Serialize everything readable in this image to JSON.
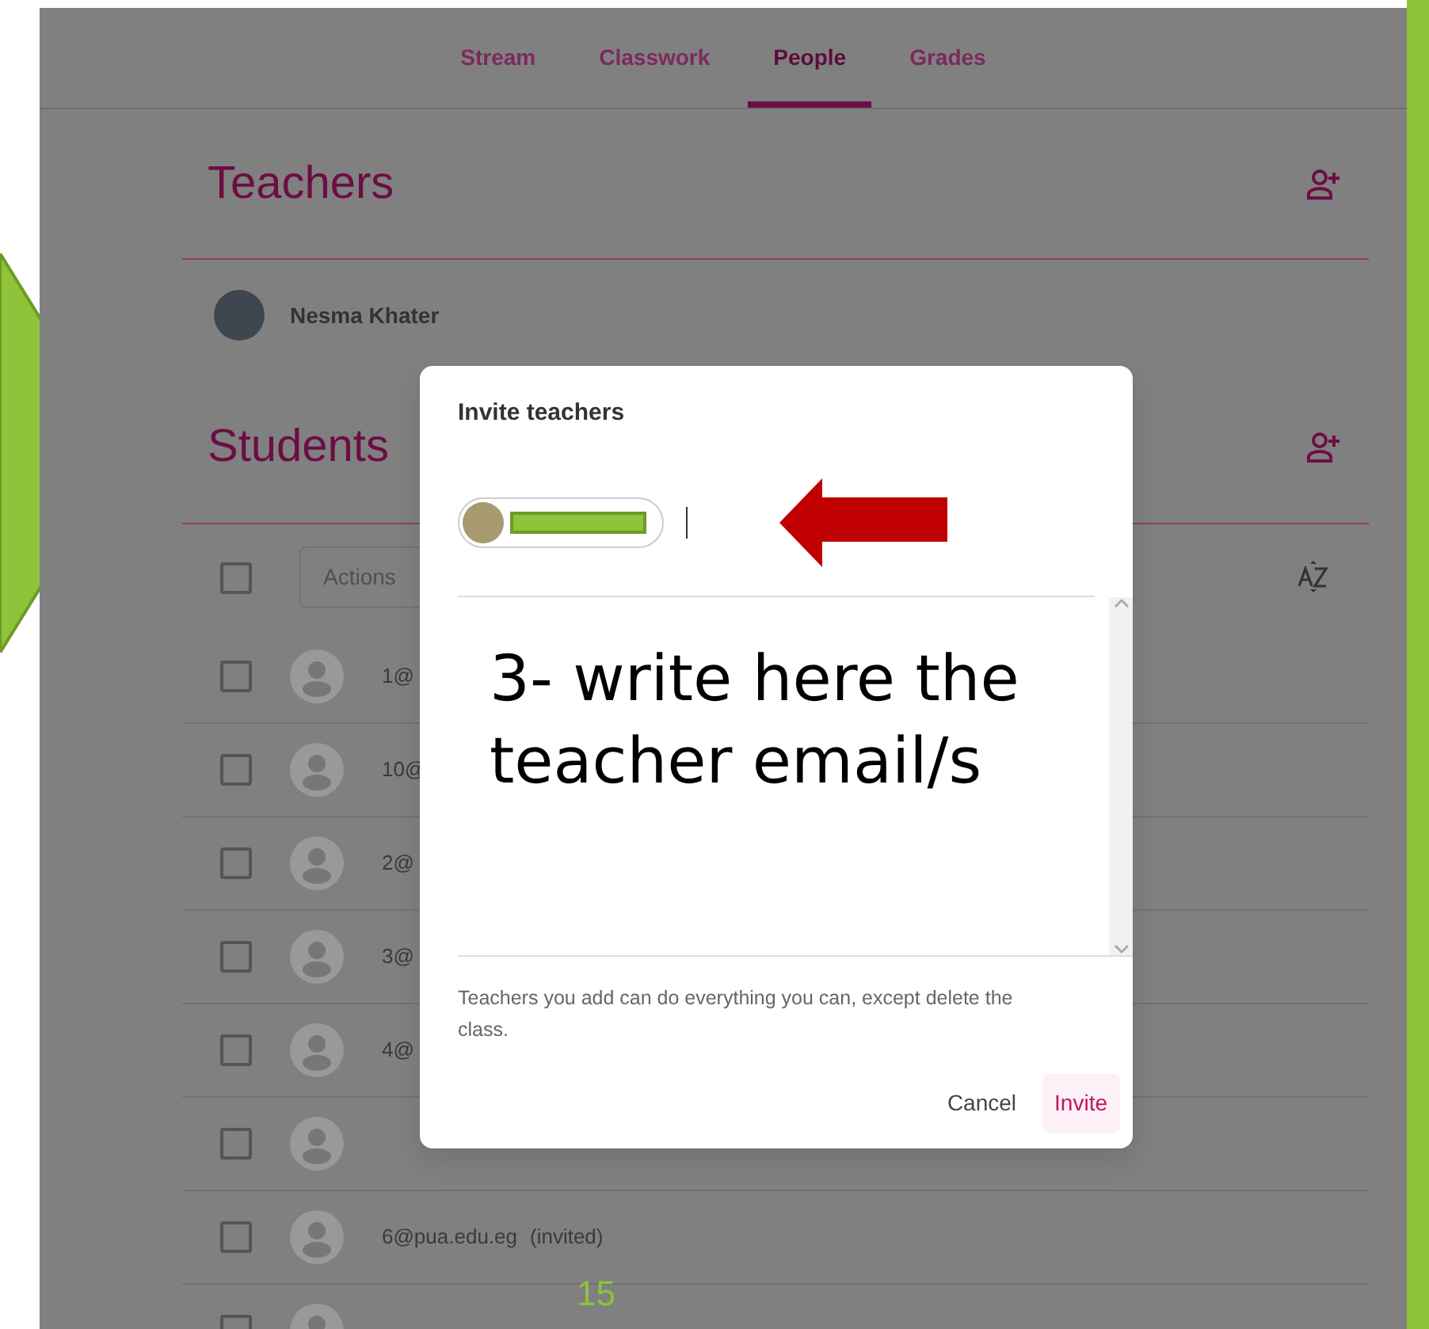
{
  "tabs": [
    {
      "label": "Stream",
      "selected": false
    },
    {
      "label": "Classwork",
      "selected": false
    },
    {
      "label": "People",
      "selected": true
    },
    {
      "label": "Grades",
      "selected": false
    }
  ],
  "teachers": {
    "title": "Teachers",
    "members": [
      {
        "name": "Nesma Khater"
      }
    ]
  },
  "students": {
    "title": "Students",
    "select_all_checked": false,
    "actions": {
      "label": "Actions"
    },
    "rows": [
      {
        "email": "1@",
        "checked": false
      },
      {
        "email": "10@",
        "checked": false
      },
      {
        "email": "2@",
        "checked": false
      },
      {
        "email": "3@",
        "checked": false
      },
      {
        "email": "4@",
        "checked": false
      },
      {
        "checked": false
      },
      {
        "email": "6@pua.edu.eg",
        "status": "(invited)",
        "checked": false
      },
      {
        "checked": false
      }
    ]
  },
  "dialog": {
    "title": "Invite teachers",
    "note": "Teachers you add can do everything you can, except delete the class.",
    "buttons": [
      {
        "label": "Cancel",
        "kind": "secondary"
      },
      {
        "label": "Invite",
        "kind": "primary"
      }
    ]
  },
  "slide": {
    "annotation": "3- write here the teacher email/s",
    "page_number": "15"
  }
}
